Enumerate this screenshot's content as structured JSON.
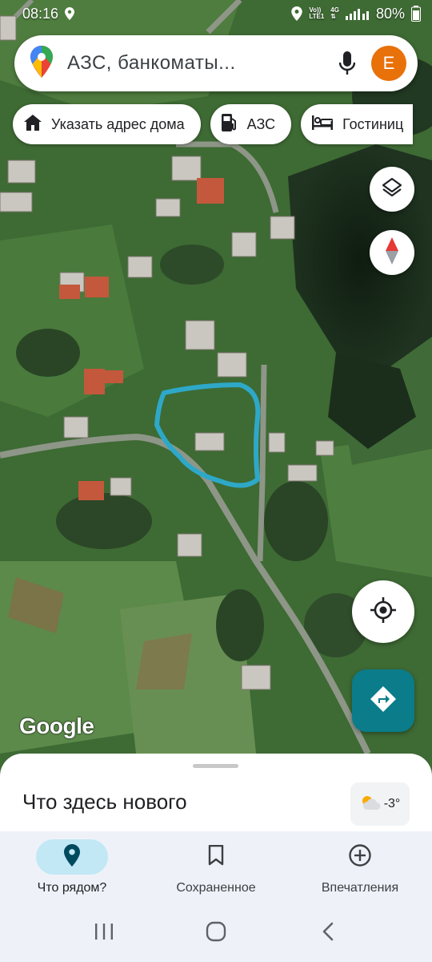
{
  "status_bar": {
    "time": "08:16",
    "network_top": "Vo))",
    "network_bottom": "LTE1",
    "network_type": "4G",
    "battery": "80%"
  },
  "search": {
    "placeholder": "АЗС, банкоматы...",
    "avatar_letter": "E"
  },
  "chips": [
    {
      "label": "Указать адрес дома",
      "icon": "home-icon"
    },
    {
      "label": "АЗС",
      "icon": "gas-station-icon"
    },
    {
      "label": "Гостиниц",
      "icon": "hotel-icon"
    }
  ],
  "map": {
    "logo": "Google",
    "buttons": [
      "layers-icon",
      "compass-icon",
      "my-location-icon",
      "directions-icon"
    ]
  },
  "sheet": {
    "title": "Что здесь нового",
    "weather": "-3°",
    "weather_icon": "partly-cloudy-icon"
  },
  "bottom_nav": [
    {
      "label": "Что рядом?",
      "icon": "place-pin-icon",
      "active": true
    },
    {
      "label": "Сохраненное",
      "icon": "bookmark-icon",
      "active": false
    },
    {
      "label": "Впечатления",
      "icon": "add-circle-icon",
      "active": false
    }
  ],
  "colors": {
    "accent_teal": "#0b7c8a",
    "active_pill": "#c2e7f5",
    "avatar": "#e8710a",
    "drawn_outline": "#2ea8c8"
  }
}
